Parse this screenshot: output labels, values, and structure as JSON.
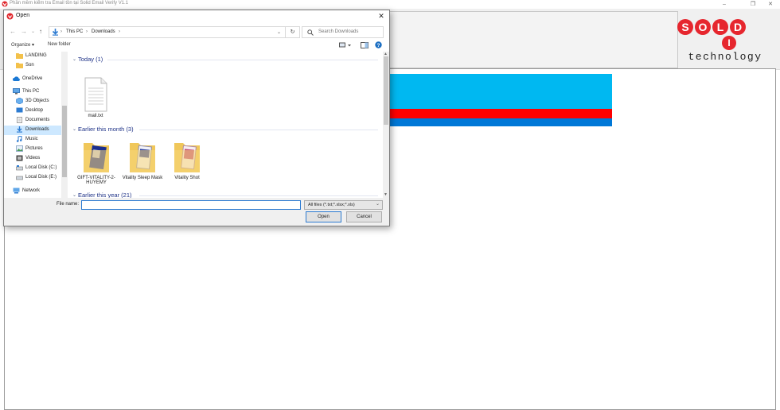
{
  "app": {
    "title": "Phần mềm kiểm tra Email tồn tại Solid Email Verify V1.1",
    "logo_text_top": "SOLID",
    "logo_text_bottom": "technology",
    "row_colors": [
      "#00b8f1",
      "#00b8f1",
      "#00b8f1",
      "#ff0000",
      "#0078d7"
    ]
  },
  "dialog": {
    "title": "Open",
    "close_glyph": "✕",
    "breadcrumb": [
      "This PC",
      "Downloads"
    ],
    "search_placeholder": "Search Downloads",
    "toolbar": {
      "organize": "Organize ▾",
      "new_folder": "New folder"
    },
    "nav_items": [
      {
        "label": "LANDING",
        "icon": "folder-icon"
      },
      {
        "label": "Son",
        "icon": "folder-icon"
      },
      {
        "label": "OneDrive",
        "icon": "cloud-icon"
      },
      {
        "label": "This PC",
        "icon": "pc-icon"
      },
      {
        "label": "3D Objects",
        "icon": "cube-icon"
      },
      {
        "label": "Desktop",
        "icon": "desktop-icon"
      },
      {
        "label": "Documents",
        "icon": "documents-icon"
      },
      {
        "label": "Downloads",
        "icon": "download-icon",
        "selected": true
      },
      {
        "label": "Music",
        "icon": "music-icon"
      },
      {
        "label": "Pictures",
        "icon": "pictures-icon"
      },
      {
        "label": "Videos",
        "icon": "videos-icon"
      },
      {
        "label": "Local Disk (C:)",
        "icon": "disk-icon"
      },
      {
        "label": "Local Disk (E:)",
        "icon": "disk-icon"
      },
      {
        "label": "Network",
        "icon": "network-icon"
      }
    ],
    "groups": [
      {
        "label": "Today (1)",
        "files": [
          "mail.txt"
        ]
      },
      {
        "label": "Earlier this month (3)",
        "files": [
          "GIFT-VITALITY-2-HUYEMY",
          "Vitality Sleep Mask",
          "Vitality Shot"
        ]
      },
      {
        "label": "Earlier this year (21)",
        "files": []
      }
    ],
    "file_name_label": "File name:",
    "file_name_value": "",
    "file_type_selected": "All files (*.txt;*.xlsx;*.xls)",
    "open_label": "Open",
    "cancel_label": "Cancel"
  }
}
